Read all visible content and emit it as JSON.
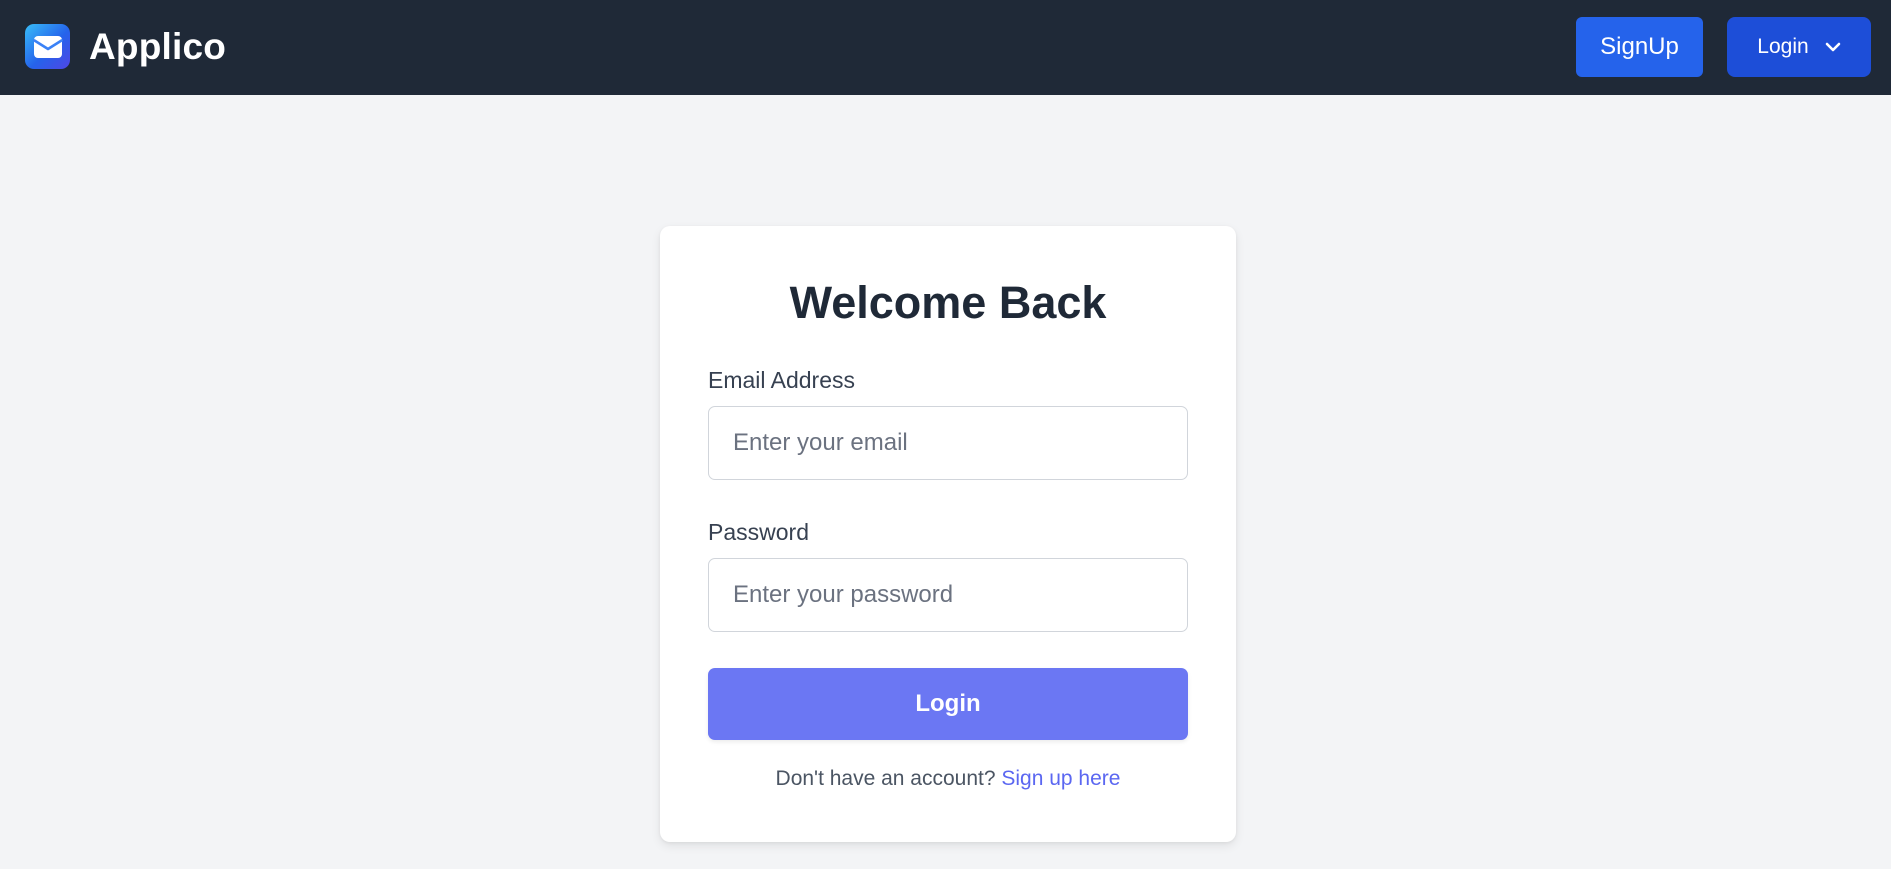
{
  "colors": {
    "header_bg": "#1f2937",
    "page_bg": "#f3f4f6",
    "signup_button_bg": "#2563eb",
    "login_button_bg": "#1d4ed8",
    "primary_action": "#6b77f3",
    "link": "#5b67f1"
  },
  "header": {
    "logo_icon": "envelope-icon",
    "brand_name": "Applico",
    "signup_label": "SignUp",
    "login_label": "Login",
    "login_dropdown_icon": "chevron-down-icon"
  },
  "login_card": {
    "title": "Welcome Back",
    "email": {
      "label": "Email Address",
      "placeholder": "Enter your email",
      "value": ""
    },
    "password": {
      "label": "Password",
      "placeholder": "Enter your password",
      "value": ""
    },
    "submit_label": "Login",
    "footer_prompt": "Don't have an account?",
    "footer_link": "Sign up here"
  }
}
